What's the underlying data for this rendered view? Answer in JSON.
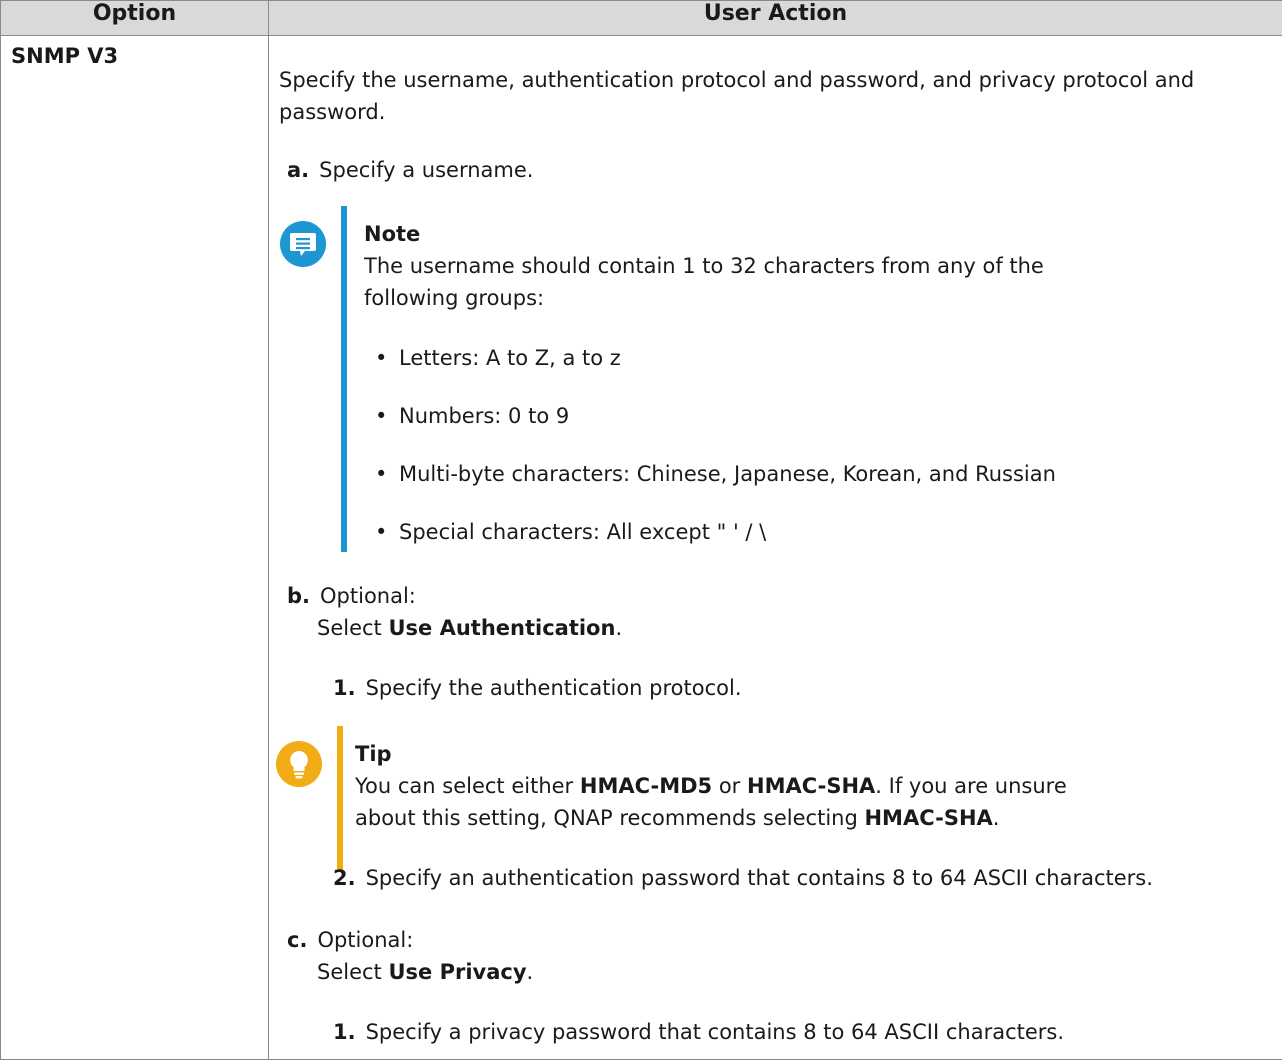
{
  "table": {
    "headers": [
      "Option",
      "User Action"
    ],
    "option": "SNMP V3"
  },
  "intro": "Specify the username, authentication protocol and password, and privacy protocol and password.",
  "step_a": {
    "label": "a.",
    "text": "Specify a username."
  },
  "note": {
    "icon": "note-icon",
    "accent_color": "#1e96d2",
    "title": "Note",
    "line1": "The username should contain 1 to 32 characters from any of the",
    "line2": "following groups:",
    "bullets": [
      "Letters: A to Z, a to z",
      "Numbers: 0 to 9",
      "Multi-byte characters: Chinese, Japanese, Korean, and Russian",
      "Special characters: All except \" ' / \\"
    ]
  },
  "step_b": {
    "label": "b.",
    "optional": "Optional:",
    "select_prefix": "Select ",
    "select_bold": "Use Authentication",
    "select_suffix": ".",
    "substeps": [
      {
        "label": "1.",
        "text": "Specify the authentication protocol."
      },
      {
        "label": "2.",
        "text": "Specify an authentication password that contains 8 to 64 ASCII characters."
      }
    ]
  },
  "tip": {
    "icon": "lightbulb-icon",
    "accent_color": "#f2ac16",
    "title": "Tip",
    "l1_a": "You can select either ",
    "l1_b": "HMAC-MD5",
    "l1_c": " or ",
    "l1_d": "HMAC-SHA",
    "l1_e": ". If you are unsure",
    "l2_a": "about this setting, QNAP recommends selecting ",
    "l2_b": "HMAC-SHA",
    "l2_c": "."
  },
  "step_c": {
    "label": "c.",
    "optional": "Optional:",
    "select_prefix": "Select ",
    "select_bold": "Use Privacy",
    "select_suffix": ".",
    "substeps": [
      {
        "label": "1.",
        "text": "Specify a privacy password that contains 8 to 64 ASCII characters."
      }
    ]
  }
}
